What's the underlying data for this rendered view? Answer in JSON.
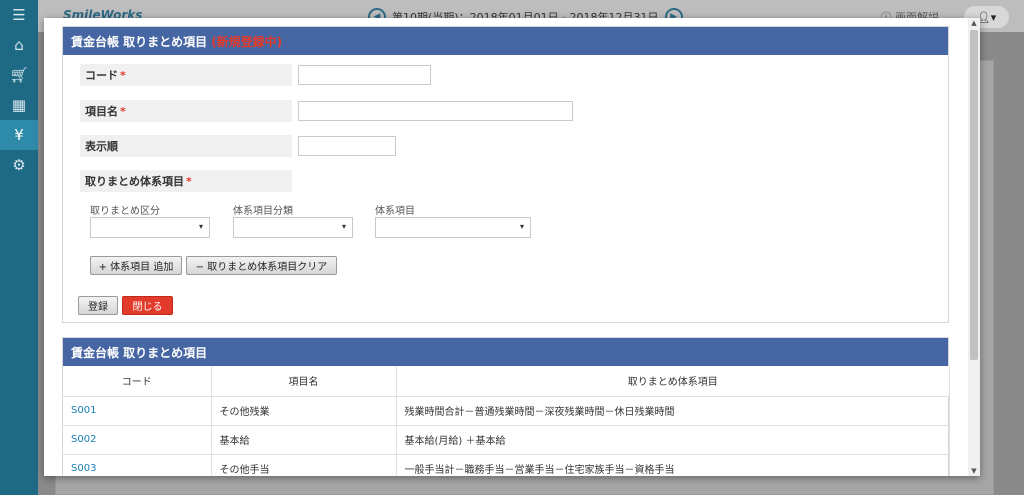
{
  "app": {
    "logo": "SmileWorks",
    "period": "第10期(当期)：2018年01月01日 - 2018年12月31日",
    "help_label": "画面解説"
  },
  "nav": {
    "icons": [
      "menu-icon",
      "home-icon",
      "cart-icon",
      "calculator-icon",
      "money-bag-icon",
      "gear-icon"
    ]
  },
  "form": {
    "title": "賃金台帳 取りまとめ項目",
    "mode": "(新規登録中)",
    "fields": {
      "code_label": "コード",
      "name_label": "項目名",
      "order_label": "表示順",
      "system_label": "取りまとめ体系項目",
      "required_mark": "*",
      "code_value": "",
      "name_value": "",
      "order_value": ""
    },
    "subs": {
      "category_label": "取りまとめ区分",
      "class_label": "体系項目分類",
      "item_label": "体系項目"
    },
    "buttons": {
      "add": "+ 体系項目 追加",
      "clear": "− 取りまとめ体系項目クリア",
      "save": "登録",
      "close": "閉じる"
    }
  },
  "list": {
    "title": "賃金台帳 取りまとめ項目",
    "columns": [
      "コード",
      "項目名",
      "取りまとめ体系項目"
    ],
    "rows": [
      {
        "code": "S001",
        "name": "その他残業",
        "items": "残業時間合計－普通残業時間－深夜残業時間－休日残業時間"
      },
      {
        "code": "S002",
        "name": "基本給",
        "items": "基本給(月給) ＋基本給"
      },
      {
        "code": "S003",
        "name": "その他手当",
        "items": "一般手当計－職務手当－営業手当－住宅家族手当－資格手当"
      }
    ]
  }
}
